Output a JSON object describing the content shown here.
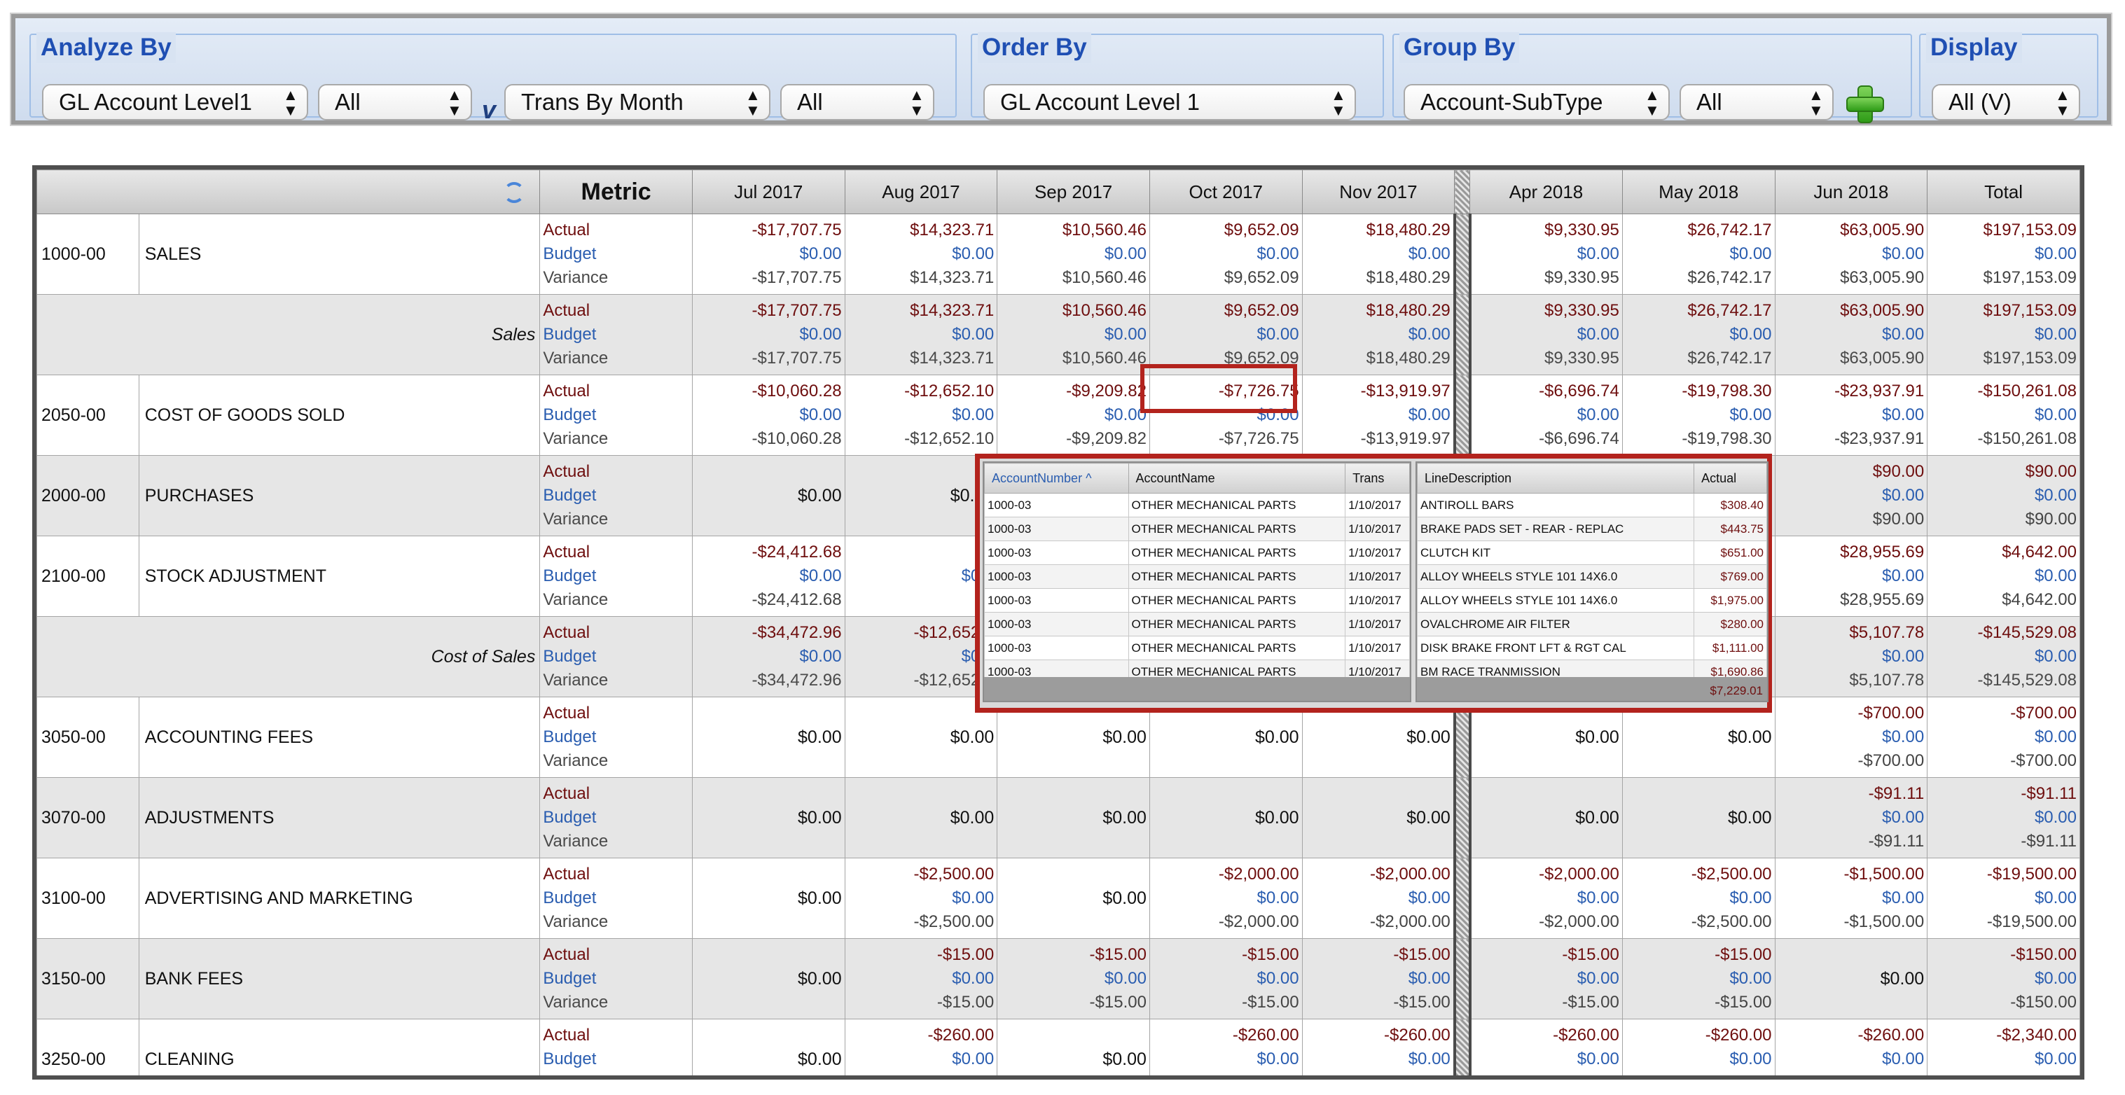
{
  "toolbar": {
    "analyze_by": {
      "title": "Analyze By",
      "selects": [
        "GL Account Level1",
        "All",
        "Trans By Month",
        "All"
      ],
      "versus": "v"
    },
    "order_by": {
      "title": "Order By",
      "selects": [
        "GL Account Level 1"
      ]
    },
    "group_by": {
      "title": "Group By",
      "selects": [
        "Account-SubType",
        "All"
      ],
      "add_icon": "plus-icon"
    },
    "display": {
      "title": "Display",
      "selects": [
        "All (V)"
      ]
    }
  },
  "table": {
    "metric_header": "Metric",
    "months_left": [
      "Jul 2017",
      "Aug 2017",
      "Sep 2017",
      "Oct 2017",
      "Nov 2017"
    ],
    "months_right": [
      "Apr 2018",
      "May 2018",
      "Jun 2018",
      "Total"
    ],
    "metric_labels": [
      "Actual",
      "Budget",
      "Variance"
    ],
    "rows": [
      {
        "acct": "1000-00",
        "name": "SALES",
        "subtotal": "",
        "grey": false,
        "left": [
          [
            "-$17,707.75",
            "$0.00",
            "-$17,707.75"
          ],
          [
            "$14,323.71",
            "$0.00",
            "$14,323.71"
          ],
          [
            "$10,560.46",
            "$0.00",
            "$10,560.46"
          ],
          [
            "$9,652.09",
            "$0.00",
            "$9,652.09"
          ],
          [
            "$18,480.29",
            "$0.00",
            "$18,480.29"
          ]
        ],
        "right": [
          [
            "$9,330.95",
            "$0.00",
            "$9,330.95"
          ],
          [
            "$26,742.17",
            "$0.00",
            "$26,742.17"
          ],
          [
            "$63,005.90",
            "$0.00",
            "$63,005.90"
          ],
          [
            "$197,153.09",
            "$0.00",
            "$197,153.09"
          ]
        ]
      },
      {
        "acct": "",
        "name": "",
        "subtotal": "Sales",
        "grey": true,
        "left": [
          [
            "-$17,707.75",
            "$0.00",
            "-$17,707.75"
          ],
          [
            "$14,323.71",
            "$0.00",
            "$14,323.71"
          ],
          [
            "$10,560.46",
            "$0.00",
            "$10,560.46"
          ],
          [
            "$9,652.09",
            "$0.00",
            "$9,652.09"
          ],
          [
            "$18,480.29",
            "$0.00",
            "$18,480.29"
          ]
        ],
        "right": [
          [
            "$9,330.95",
            "$0.00",
            "$9,330.95"
          ],
          [
            "$26,742.17",
            "$0.00",
            "$26,742.17"
          ],
          [
            "$63,005.90",
            "$0.00",
            "$63,005.90"
          ],
          [
            "$197,153.09",
            "$0.00",
            "$197,153.09"
          ]
        ]
      },
      {
        "acct": "2050-00",
        "name": "COST OF GOODS SOLD",
        "subtotal": "",
        "grey": false,
        "left": [
          [
            "-$10,060.28",
            "$0.00",
            "-$10,060.28"
          ],
          [
            "-$12,652.10",
            "$0.00",
            "-$12,652.10"
          ],
          [
            "-$9,209.82",
            "$0.00",
            "-$9,209.82"
          ],
          [
            "-$7,726.75",
            "$0.00",
            "-$7,726.75"
          ],
          [
            "-$13,919.97",
            "$0.00",
            "-$13,919.97"
          ]
        ],
        "right": [
          [
            "-$6,696.74",
            "$0.00",
            "-$6,696.74"
          ],
          [
            "-$19,798.30",
            "$0.00",
            "-$19,798.30"
          ],
          [
            "-$23,937.91",
            "$0.00",
            "-$23,937.91"
          ],
          [
            "-$150,261.08",
            "$0.00",
            "-$150,261.08"
          ]
        ]
      },
      {
        "acct": "2000-00",
        "name": "PURCHASES",
        "subtotal": "",
        "grey": true,
        "left": [
          "$0.00",
          "$0.00",
          "",
          "",
          ""
        ],
        "right": [
          [
            "",
            "",
            ""
          ],
          [
            "",
            "",
            ""
          ],
          [
            "$90.00",
            "$0.00",
            "$90.00"
          ],
          [
            "$90.00",
            "$0.00",
            "$90.00"
          ]
        ]
      },
      {
        "acct": "2100-00",
        "name": "STOCK ADJUSTMENT",
        "subtotal": "",
        "grey": false,
        "left": [
          [
            "-$24,412.68",
            "$0.00",
            "-$24,412.68"
          ],
          [
            "",
            "$0.0",
            ""
          ],
          [
            "",
            "",
            ""
          ],
          [
            "",
            "",
            ""
          ],
          [
            "",
            "",
            ""
          ]
        ],
        "right": [
          [
            "",
            "",
            ""
          ],
          [
            "",
            "",
            ""
          ],
          [
            "$28,955.69",
            "$0.00",
            "$28,955.69"
          ],
          [
            "$4,642.00",
            "$0.00",
            "$4,642.00"
          ]
        ]
      },
      {
        "acct": "",
        "name": "",
        "subtotal": "Cost of Sales",
        "grey": true,
        "left": [
          [
            "-$34,472.96",
            "$0.00",
            "-$34,472.96"
          ],
          [
            "-$12,652.1",
            "$0.0",
            "-$12,652.1"
          ],
          [
            "",
            "",
            ""
          ],
          [
            "",
            "",
            ""
          ],
          [
            "",
            "",
            ""
          ]
        ],
        "right": [
          [
            "",
            "",
            ""
          ],
          [
            "",
            "",
            ""
          ],
          [
            "$5,107.78",
            "$0.00",
            "$5,107.78"
          ],
          [
            "-$145,529.08",
            "$0.00",
            "-$145,529.08"
          ]
        ]
      },
      {
        "acct": "3050-00",
        "name": "ACCOUNTING FEES",
        "subtotal": "",
        "grey": false,
        "left": [
          "$0.00",
          "$0.00",
          "$0.00",
          "$0.00",
          "$0.00"
        ],
        "right": [
          "$0.00",
          "$0.00",
          [
            "-$700.00",
            "$0.00",
            "-$700.00"
          ],
          [
            "-$700.00",
            "$0.00",
            "-$700.00"
          ]
        ]
      },
      {
        "acct": "3070-00",
        "name": "ADJUSTMENTS",
        "subtotal": "",
        "grey": true,
        "left": [
          "$0.00",
          "$0.00",
          "$0.00",
          "$0.00",
          "$0.00"
        ],
        "right": [
          "$0.00",
          "$0.00",
          [
            "-$91.11",
            "$0.00",
            "-$91.11"
          ],
          [
            "-$91.11",
            "$0.00",
            "-$91.11"
          ]
        ]
      },
      {
        "acct": "3100-00",
        "name": "ADVERTISING AND MARKETING",
        "subtotal": "",
        "grey": false,
        "left": [
          "$0.00",
          [
            "-$2,500.00",
            "$0.00",
            "-$2,500.00"
          ],
          "$0.00",
          [
            "-$2,000.00",
            "$0.00",
            "-$2,000.00"
          ],
          [
            "-$2,000.00",
            "$0.00",
            "-$2,000.00"
          ]
        ],
        "right": [
          [
            "-$2,000.00",
            "$0.00",
            "-$2,000.00"
          ],
          [
            "-$2,500.00",
            "$0.00",
            "-$2,500.00"
          ],
          [
            "-$1,500.00",
            "$0.00",
            "-$1,500.00"
          ],
          [
            "-$19,500.00",
            "$0.00",
            "-$19,500.00"
          ]
        ]
      },
      {
        "acct": "3150-00",
        "name": "BANK FEES",
        "subtotal": "",
        "grey": true,
        "left": [
          "$0.00",
          [
            "-$15.00",
            "$0.00",
            "-$15.00"
          ],
          [
            "-$15.00",
            "$0.00",
            "-$15.00"
          ],
          [
            "-$15.00",
            "$0.00",
            "-$15.00"
          ],
          [
            "-$15.00",
            "$0.00",
            "-$15.00"
          ]
        ],
        "right": [
          [
            "-$15.00",
            "$0.00",
            "-$15.00"
          ],
          [
            "-$15.00",
            "$0.00",
            "-$15.00"
          ],
          "$0.00",
          [
            "-$150.00",
            "$0.00",
            "-$150.00"
          ]
        ]
      },
      {
        "acct": "3250-00",
        "name": "CLEANING",
        "subtotal": "",
        "grey": false,
        "left": [
          "$0.00",
          [
            "-$260.00",
            "$0.00",
            "-$260.00"
          ],
          "$0.00",
          [
            "-$260.00",
            "$0.00",
            "-$260.00"
          ],
          [
            "-$260.00",
            "$0.00",
            "-$260.00"
          ]
        ],
        "right": [
          [
            "-$260.00",
            "$0.00",
            "-$260.00"
          ],
          [
            "-$260.00",
            "$0.00",
            "-$260.00"
          ],
          [
            "-$260.00",
            "$0.00",
            "-$260.00"
          ],
          [
            "-$2,340.00",
            "$0.00",
            "-$2,340.00"
          ]
        ]
      }
    ]
  },
  "popup": {
    "left_headers": [
      "AccountNumber",
      "AccountName",
      "Trans"
    ],
    "right_headers": [
      "LineDescription",
      "Actual"
    ],
    "rows": [
      [
        "1000-03",
        "OTHER MECHANICAL PARTS",
        "1/10/2017",
        "ANTIROLL BARS",
        "$308.40"
      ],
      [
        "1000-03",
        "OTHER MECHANICAL PARTS",
        "1/10/2017",
        "BRAKE PADS SET - REAR - REPLAC",
        "$443.75"
      ],
      [
        "1000-03",
        "OTHER MECHANICAL PARTS",
        "1/10/2017",
        "CLUTCH KIT",
        "$651.00"
      ],
      [
        "1000-03",
        "OTHER MECHANICAL PARTS",
        "1/10/2017",
        "ALLOY WHEELS STYLE 101 14X6.0",
        "$769.00"
      ],
      [
        "1000-03",
        "OTHER MECHANICAL PARTS",
        "1/10/2017",
        "ALLOY WHEELS STYLE 101 14X6.0",
        "$1,975.00"
      ],
      [
        "1000-03",
        "OTHER MECHANICAL PARTS",
        "1/10/2017",
        "OVALCHROME AIR FILTER",
        "$280.00"
      ],
      [
        "1000-03",
        "OTHER MECHANICAL PARTS",
        "1/10/2017",
        "DISK BRAKE FRONT LFT & RGT CAL",
        "$1,111.00"
      ],
      [
        "1000-03",
        "OTHER MECHANICAL PARTS",
        "1/10/2017",
        "BM RACE TRANMISSION",
        "$1,690.86"
      ]
    ],
    "total": "$7,229.01"
  },
  "colors": {
    "title_blue": "#1f4fb3",
    "actual": "#6e0e0e",
    "budget": "#2a5db0",
    "highlight": "#b3231d"
  }
}
